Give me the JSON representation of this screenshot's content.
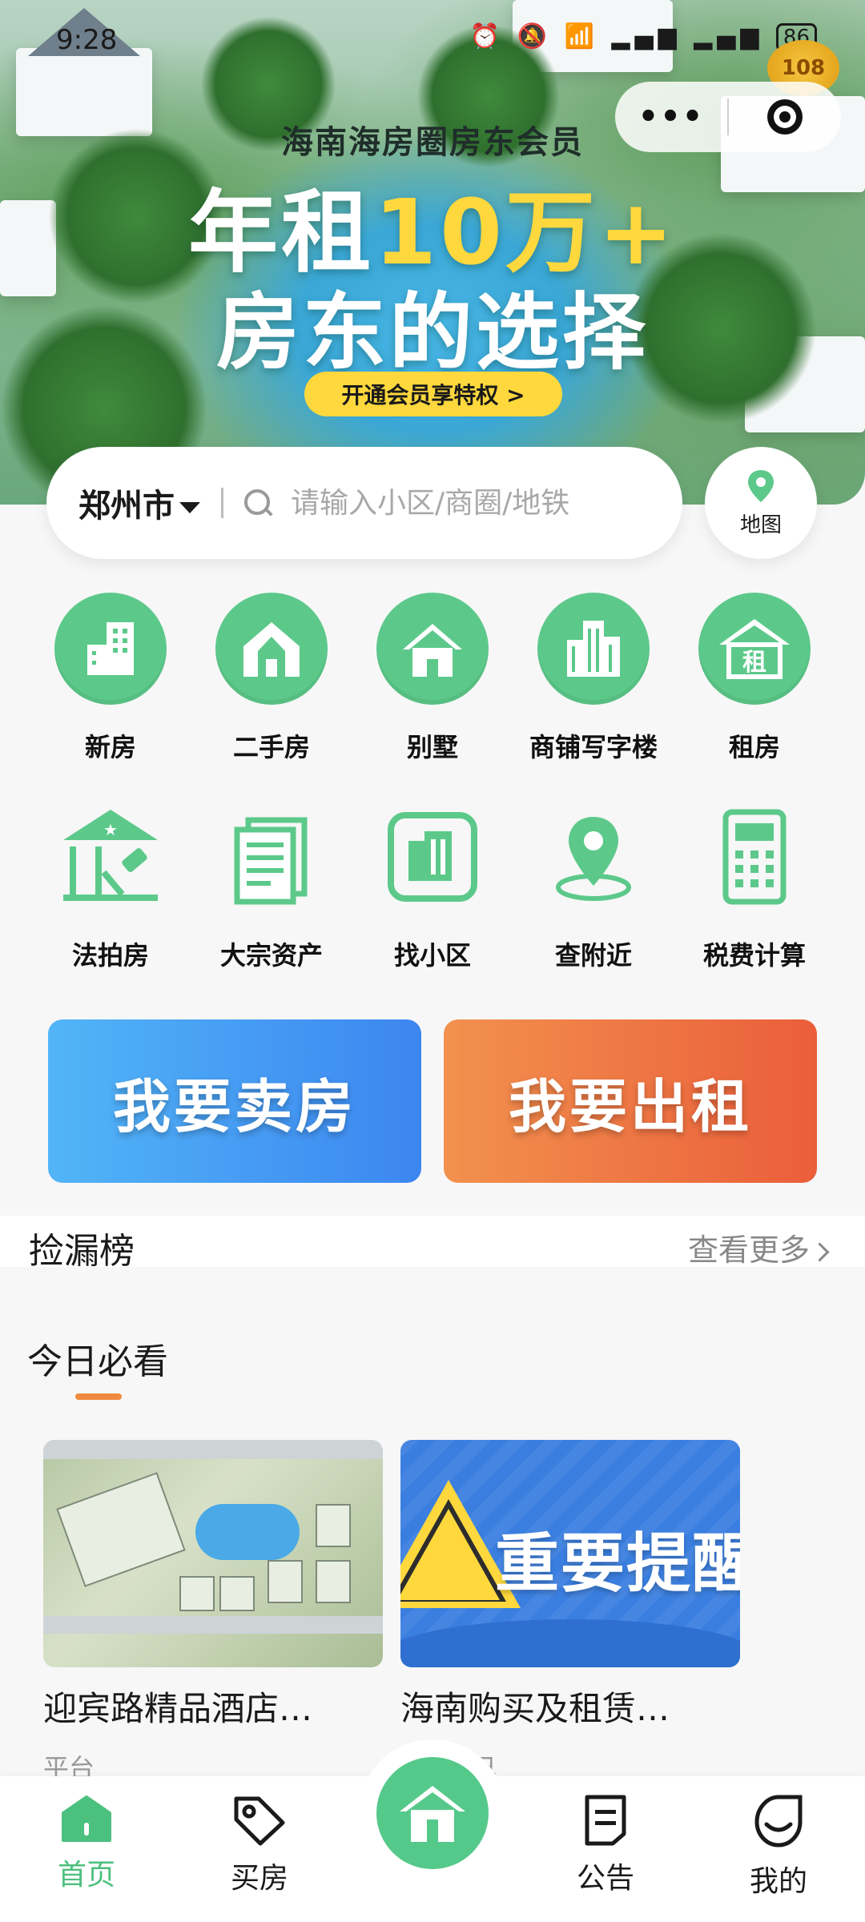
{
  "status_bar": {
    "time": "9:28",
    "battery": "86"
  },
  "mini_program": {
    "badge": "108"
  },
  "banner": {
    "subtitle": "海南海房圈房东会员",
    "line1_prefix": "年租",
    "line1_highlight": "10万+",
    "line2": "房东的选择",
    "cta": "开通会员享特权 >"
  },
  "search": {
    "city": "郑州市",
    "placeholder": "请输入小区/商圈/地铁"
  },
  "map_button": {
    "label": "地图"
  },
  "categories_row1": [
    {
      "label": "新房",
      "icon": "new-house-icon"
    },
    {
      "label": "二手房",
      "icon": "second-hand-house-icon"
    },
    {
      "label": "别墅",
      "icon": "villa-icon"
    },
    {
      "label": "商铺写字楼",
      "icon": "office-building-icon"
    },
    {
      "label": "租房",
      "icon": "rent-house-icon"
    }
  ],
  "categories_row2": [
    {
      "label": "法拍房",
      "icon": "auction-house-icon"
    },
    {
      "label": "大宗资产",
      "icon": "bulk-asset-icon"
    },
    {
      "label": "找小区",
      "icon": "community-icon"
    },
    {
      "label": "查附近",
      "icon": "nearby-location-icon"
    },
    {
      "label": "税费计算",
      "icon": "calculator-icon"
    }
  ],
  "actions": {
    "sell": "我要卖房",
    "rent": "我要出租"
  },
  "bargain_section": {
    "title": "捡漏榜",
    "more": "查看更多"
  },
  "today": {
    "title": "今日必看",
    "cards": [
      {
        "title": "迎宾路精品酒店…",
        "source": "平台"
      },
      {
        "title": "海南购买及租赁…",
        "source": "自己",
        "image_text": "重要提醒"
      }
    ]
  },
  "tabbar": {
    "items": [
      {
        "label": "首页"
      },
      {
        "label": "买房"
      },
      {
        "label": "公告"
      },
      {
        "label": "我的"
      }
    ]
  },
  "colors": {
    "brand_green": "#5cc98a",
    "accent_orange": "#f08a3e",
    "sell_blue": "#3c86f0",
    "rent_red": "#eb5e3a"
  }
}
